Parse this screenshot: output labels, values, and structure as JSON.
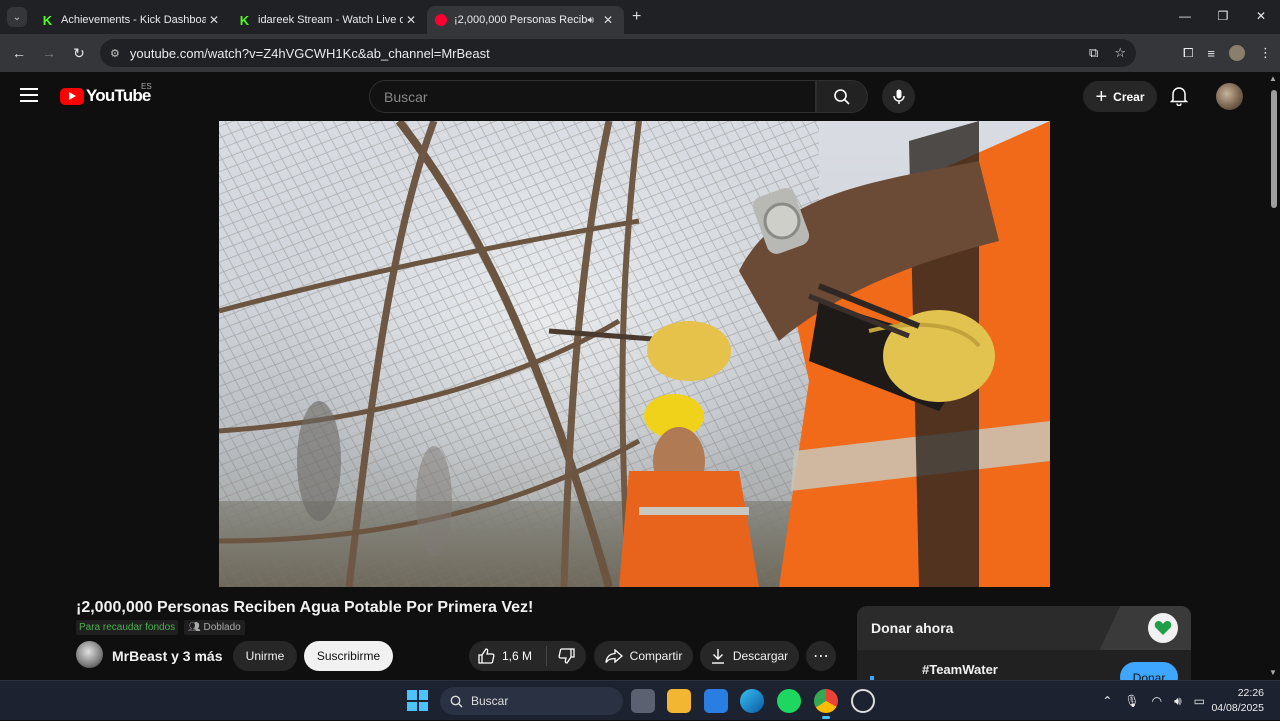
{
  "browser": {
    "tabs": [
      {
        "title": "Achievements - Kick Dashboard",
        "favicon": "kick-icon",
        "active": false
      },
      {
        "title": "idareek Stream - Watch Live on",
        "favicon": "kick-icon",
        "active": false
      },
      {
        "title": "¡2,000,000 Personas Reciben",
        "favicon": "youtube-icon",
        "active": true
      }
    ],
    "url": "youtube.com/watch?v=Z4hVGCWH1Kc&ab_channel=MrBeast"
  },
  "youtube": {
    "logo_text": "YouTube",
    "region": "ES",
    "search_placeholder": "Buscar",
    "create_label": "Crear"
  },
  "video": {
    "title": "¡2,000,000 Personas Reciben Agua Potable Por Primera Vez!",
    "fundraiser_badge": "Para recaudar fondos",
    "dub_badge": "Doblado",
    "channel": "MrBeast y 3 más",
    "join_label": "Unirme",
    "subscribe_label": "Suscribirme",
    "likes": "1,6 M",
    "share_label": "Compartir",
    "download_label": "Descargar"
  },
  "donate": {
    "title": "Donar ahora",
    "tag": "#TeamWater",
    "button": "Donar"
  },
  "taskbar": {
    "search": "Buscar",
    "time": "22:26",
    "date": "04/08/2025"
  },
  "colors": {
    "yt_red": "#ff0000",
    "accent_blue": "#3ea6ff",
    "kick_green": "#53fc18"
  }
}
